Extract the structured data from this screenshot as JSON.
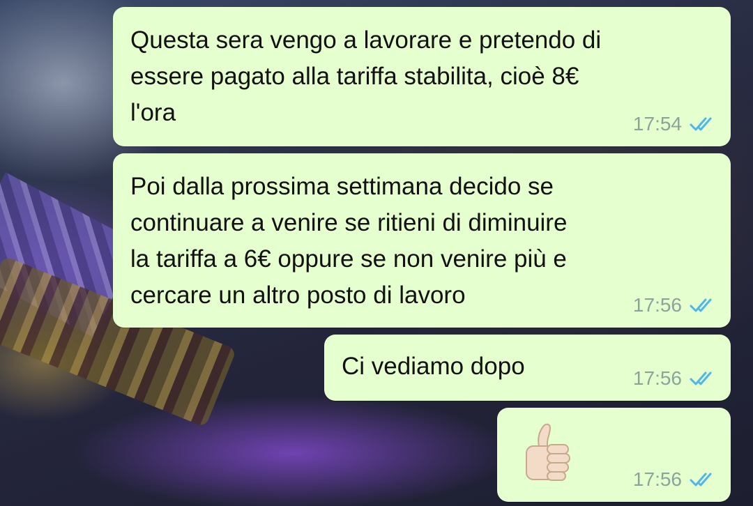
{
  "messages": [
    {
      "text": "Questa sera vengo a lavorare e pretendo di\nessere pagato alla tariffa stabilita, cioè 8€\nl'ora",
      "time": "17:54",
      "status": "read-double-check-icon"
    },
    {
      "text": "Poi dalla prossima settimana decido se\ncontinuare a venire se ritieni di diminuire\nla tariffa a 6€ oppure se non venire più e\ncercare un altro posto di lavoro",
      "time": "17:56",
      "status": "read-double-check-icon"
    },
    {
      "text": "Ci vediamo dopo",
      "time": "17:56",
      "status": "read-double-check-icon"
    },
    {
      "emoji": "thumbs-up-icon",
      "time": "17:56",
      "status": "read-double-check-icon"
    }
  ],
  "colors": {
    "outgoing_bubble": "#e6ffcf",
    "read_ticks": "#4fb6ec",
    "timestamp": "#8aa49a"
  }
}
